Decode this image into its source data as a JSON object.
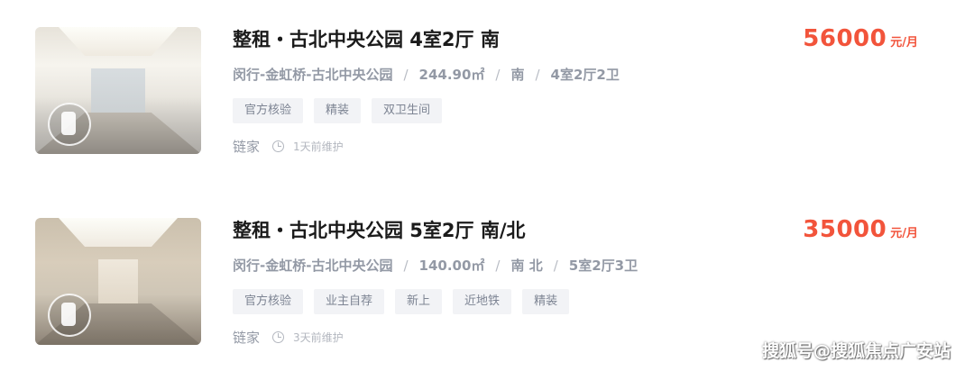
{
  "listings": [
    {
      "title": "整租・古北中央公园 4室2厅 南",
      "district": "闵行-金虹桥-古北中央公园",
      "area": "244.90㎡",
      "orientation": "南",
      "layout": "4室2厅2卫",
      "separator": "/",
      "tags": [
        "官方核验",
        "精装",
        "双卫生间"
      ],
      "agency": "链家",
      "updated": "1天前维护",
      "price": "56000",
      "price_unit": "元/月"
    },
    {
      "title": "整租・古北中央公园 5室2厅 南/北",
      "district": "闵行-金虹桥-古北中央公园",
      "area": "140.00㎡",
      "orientation": "南 北",
      "layout": "5室2厅3卫",
      "separator": "/",
      "tags": [
        "官方核验",
        "业主自荐",
        "新上",
        "近地铁",
        "精装"
      ],
      "agency": "链家",
      "updated": "3天前维护",
      "price": "35000",
      "price_unit": "元/月"
    }
  ],
  "watermark": "搜狐号@搜狐焦点广安站",
  "colors": {
    "price": "#f2543b",
    "tag_bg": "#f2f3f6",
    "meta": "#9399a5"
  }
}
